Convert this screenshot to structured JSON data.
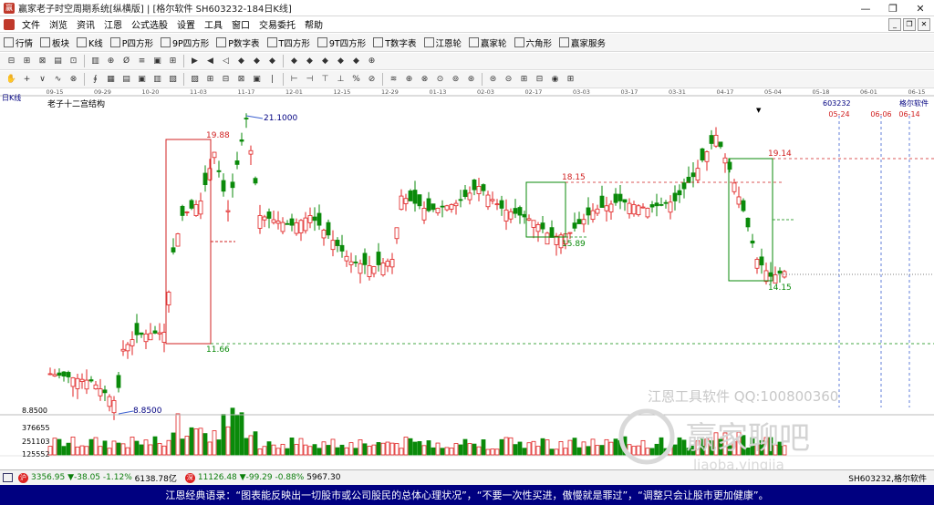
{
  "window": {
    "title": "赢家老子时空周期系统[纵横版] | [格尔软件  SH603232-184日K线]",
    "buttons": [
      "—",
      "❐",
      "✕"
    ]
  },
  "menu": {
    "items": [
      "文件",
      "浏览",
      "资讯",
      "江恩",
      "公式选股",
      "设置",
      "工具",
      "窗口",
      "交易委托",
      "帮助"
    ]
  },
  "toolbar1": {
    "items": [
      {
        "icon": "grid-icon",
        "label": "行情"
      },
      {
        "icon": "blocks-icon",
        "label": "板块"
      },
      {
        "icon": "kline-icon",
        "label": "K线"
      },
      {
        "icon": "p-square-icon",
        "label": "P四方形"
      },
      {
        "icon": "9p-square-icon",
        "label": "9P四方形"
      },
      {
        "icon": "p-number-icon",
        "label": "P数字表"
      },
      {
        "icon": "t-square-icon",
        "label": "T四方形"
      },
      {
        "icon": "9t-square-icon",
        "label": "9T四方形"
      },
      {
        "icon": "t-number-icon",
        "label": "T数字表"
      },
      {
        "icon": "wheel-icon",
        "label": "江恩轮"
      },
      {
        "icon": "wheel-icon",
        "label": "赢家轮"
      },
      {
        "icon": "hexagon-icon",
        "label": "六角形"
      },
      {
        "icon": "dollar-icon",
        "label": "赢家服务"
      }
    ]
  },
  "chart_data": {
    "type": "candlestick",
    "period_label": "日K线",
    "indicator_title": "老子十二宫结构",
    "stock_code": "603232",
    "stock_name": "格尔软件",
    "dates_top": [
      "09-15",
      "09-29",
      "10-20",
      "11-03",
      "11-17",
      "12-01",
      "12-15",
      "12-29",
      "01-13",
      "02-03",
      "02-17",
      "03-03",
      "03-17",
      "03-31",
      "04-17",
      "05-04",
      "05-18",
      "06-01",
      "06-15"
    ],
    "future_dates": [
      "05-24",
      "06-06",
      "06-14"
    ],
    "price_labels": {
      "high_all": "21.1000",
      "low_all": "8.8500",
      "axis_low": "8.8500"
    },
    "boxes": [
      {
        "top": "19.88",
        "bottom": "11.66"
      },
      {
        "top": "18.15",
        "bottom": "15.89"
      },
      {
        "top": "19.14",
        "bottom": "14.15"
      }
    ],
    "volume_labels": [
      "376655",
      "251103",
      "125552"
    ],
    "watermark_lines": [
      "江恩工具软件  QQ:100800360",
      "赢家聊吧",
      "liaoba.yingjia"
    ],
    "colors": {
      "up": "#e02020",
      "down": "#0a8a0a",
      "box": "#d02020",
      "box2": "#0a8a0a",
      "hline": "#d02020",
      "vline": "#3a5fd0"
    }
  },
  "statusbar": {
    "sh_index": "3356.95",
    "sh_change": "▼-38.05",
    "sh_pct": "-1.12%",
    "sh_amount": "6138.78亿",
    "sz_index": "11126.48",
    "sz_change": "▼-99.29",
    "sz_pct": "-0.88%",
    "sz_amount": "5967.30",
    "right_text": "SH603232,格尔软件"
  },
  "quote": {
    "text": "江恩经典语录：“图表能反映出一切股市或公司股民的总体心理状况”，“不要一次性买进，傲慢就是罪过”，“调整只会让股市更加健康”。"
  }
}
